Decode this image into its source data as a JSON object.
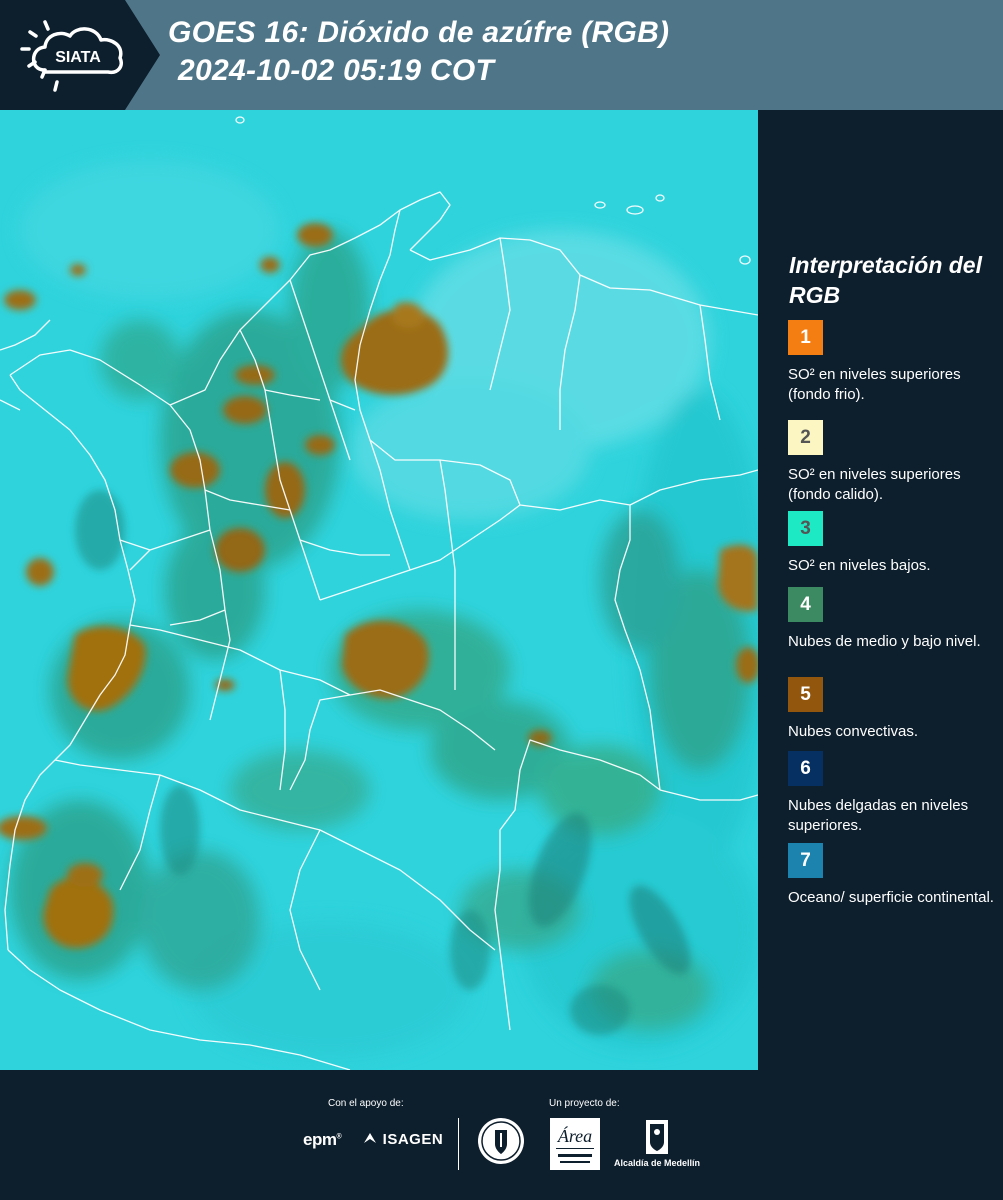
{
  "header": {
    "logo_text": "SIATA",
    "title_line1": "GOES 16: Dióxido de azúfre (RGB)",
    "title_line2": "2024-10-02 05:19 COT"
  },
  "legend": {
    "title": "Interpretación del RGB",
    "items": [
      {
        "number": "1",
        "color": "#f47e12",
        "text_color": "#ffffff",
        "description": "SO² en niveles superiores (fondo frio)."
      },
      {
        "number": "2",
        "color": "#fbf6c2",
        "text_color": "#555555",
        "description": "SO² en niveles superiores (fondo calido)."
      },
      {
        "number": "3",
        "color": "#1de9c4",
        "text_color": "#555555",
        "description": "SO² en niveles bajos."
      },
      {
        "number": "4",
        "color": "#3c8a62",
        "text_color": "#ffffff",
        "description": "Nubes de medio y bajo nivel."
      },
      {
        "number": "5",
        "color": "#93560d",
        "text_color": "#ffffff",
        "description": "Nubes convectivas."
      },
      {
        "number": "6",
        "color": "#062f62",
        "text_color": "#ffffff",
        "description": "Nubes delgadas en niveles superiores."
      },
      {
        "number": "7",
        "color": "#1b83ad",
        "text_color": "#ffffff",
        "description": "Oceano/ superficie continental."
      }
    ]
  },
  "footer": {
    "support_label": "Con el apoyo de:",
    "project_label": "Un proyecto de:",
    "sponsors": [
      "epm",
      "ISAGEN"
    ],
    "partners": [
      "Área Metropolitana Valle de Aburrá",
      "Alcaldía de Medellín"
    ],
    "alcaldia_label": "Alcaldía de Medellín"
  },
  "colors": {
    "header_bg": "#4f7688",
    "page_bg": "#0d1e2c",
    "map_background": "#2fd2dc",
    "convective_cloud": "#93680e",
    "mid_low_cloud": "#3c8a62",
    "boundary_lines": "#ffffff"
  }
}
